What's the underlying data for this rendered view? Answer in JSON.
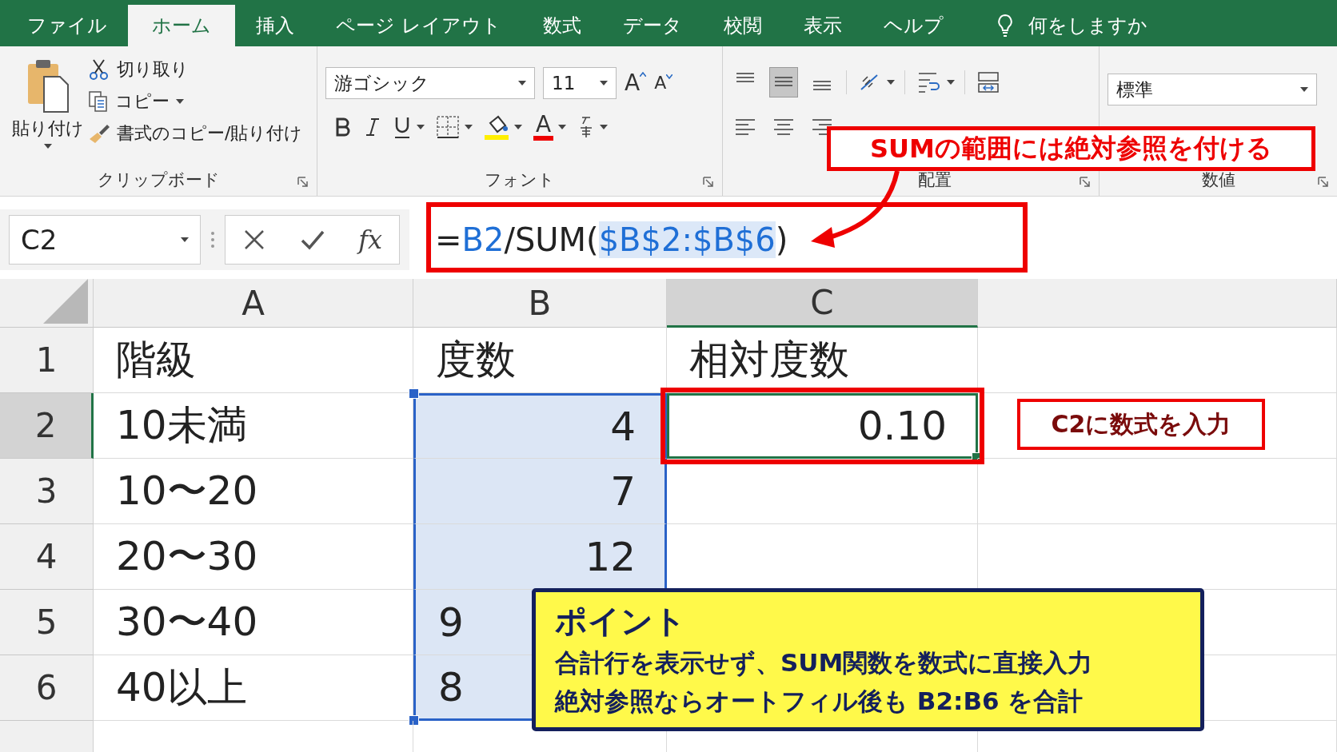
{
  "ribbon_tabs": [
    {
      "label": "ファイル",
      "selected": false
    },
    {
      "label": "ホーム",
      "selected": true
    },
    {
      "label": "挿入",
      "selected": false
    },
    {
      "label": "ページ レイアウト",
      "selected": false
    },
    {
      "label": "数式",
      "selected": false
    },
    {
      "label": "データ",
      "selected": false
    },
    {
      "label": "校閲",
      "selected": false
    },
    {
      "label": "表示",
      "selected": false
    },
    {
      "label": "ヘルプ",
      "selected": false
    }
  ],
  "tell_me": "何をしますか",
  "clipboard": {
    "paste": "貼り付け",
    "cut": "切り取り",
    "copy": "コピー",
    "format_painter": "書式のコピー/貼り付け",
    "label": "クリップボード"
  },
  "font": {
    "name": "游ゴシック",
    "size": "11",
    "grow_glyph": "A",
    "shrink_glyph": "A",
    "color_glyph": "A",
    "label": "フォント"
  },
  "alignment": {
    "label": "配置",
    "vertical_align": [
      {
        "kind": "top",
        "selected": false
      },
      {
        "kind": "middle",
        "selected": true
      },
      {
        "kind": "bottom",
        "selected": false
      }
    ],
    "horizontal_align": [
      {
        "kind": "left",
        "selected": false
      },
      {
        "kind": "center",
        "selected": false
      },
      {
        "kind": "right",
        "selected": false
      }
    ]
  },
  "number": {
    "format": "標準",
    "label": "数値"
  },
  "name_box": "C2",
  "function_glyph": "fx",
  "formula": [
    {
      "kind": "plain",
      "text": "="
    },
    {
      "kind": "ref",
      "text": "B2"
    },
    {
      "kind": "plain",
      "text": "/SUM("
    },
    {
      "kind": "range",
      "text": "$B$2:$B$6"
    },
    {
      "kind": "plain",
      "text": ")"
    }
  ],
  "sheet": {
    "columns": [
      {
        "label": "A",
        "selected": false
      },
      {
        "label": "B",
        "selected": false
      },
      {
        "label": "C",
        "selected": true
      }
    ],
    "rows": [
      {
        "header": "1",
        "selected": false,
        "cells": [
          {
            "text": "階級",
            "kind": "text"
          },
          {
            "text": "度数",
            "kind": "text"
          },
          {
            "text": "相対度数",
            "kind": "text"
          }
        ]
      },
      {
        "header": "2",
        "selected": true,
        "cells": [
          {
            "text": "10未満",
            "kind": "text"
          },
          {
            "text": "4",
            "kind": "number",
            "in_range": true
          },
          {
            "text": "0.10",
            "kind": "number",
            "active": true
          }
        ]
      },
      {
        "header": "3",
        "selected": false,
        "cells": [
          {
            "text": "10〜20",
            "kind": "text"
          },
          {
            "text": "7",
            "kind": "number",
            "in_range": true
          }
        ]
      },
      {
        "header": "4",
        "selected": false,
        "cells": [
          {
            "text": "20〜30",
            "kind": "text"
          },
          {
            "text": "12",
            "kind": "number",
            "in_range": true
          }
        ]
      },
      {
        "header": "5",
        "selected": false,
        "cells": [
          {
            "text": "30〜40",
            "kind": "text"
          },
          {
            "text": "9",
            "kind": "text",
            "in_range": true
          }
        ]
      },
      {
        "header": "6",
        "selected": false,
        "cells": [
          {
            "text": "40以上",
            "kind": "text"
          },
          {
            "text": "8",
            "kind": "text",
            "in_range": true
          }
        ]
      }
    ]
  },
  "annotations": {
    "range_note": "**SUM**の範囲には絶対参照を付ける",
    "cell_note": "C2に数式を入力",
    "point": {
      "title": "ポイント",
      "lines": [
        "合計行を表示せず、SUM関数を数式に直接入力",
        "絶対参照ならオートフィル後も B2:B6 を合計"
      ]
    }
  }
}
